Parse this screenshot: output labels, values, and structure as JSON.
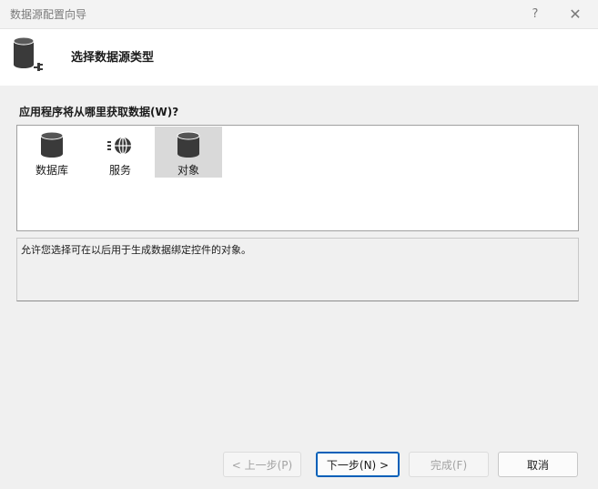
{
  "window": {
    "title": "数据源配置向导",
    "help_glyph": "?",
    "close_glyph": "✕"
  },
  "header": {
    "title": "选择数据源类型",
    "icon": "database-plug-icon"
  },
  "question": "应用程序将从哪里获取数据(W)?",
  "source_types": [
    {
      "label": "数据库",
      "icon": "database-icon",
      "selected": false
    },
    {
      "label": "服务",
      "icon": "globe-service-icon",
      "selected": false
    },
    {
      "label": "对象",
      "icon": "object-icon",
      "selected": true
    }
  ],
  "description": "允许您选择可在以后用于生成数据绑定控件的对象。",
  "buttons": {
    "back": "< 上一步(P)",
    "next": "下一步(N) >",
    "finish": "完成(F)",
    "cancel": "取消"
  },
  "colors": {
    "accent": "#005fb8",
    "selection": "#d9d9d9"
  }
}
